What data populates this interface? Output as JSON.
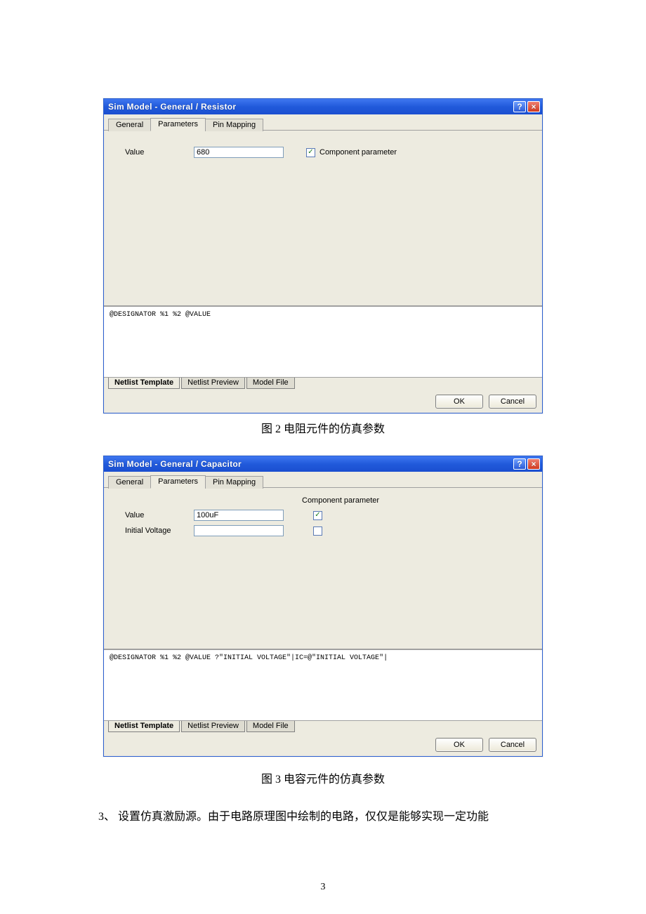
{
  "figure2": {
    "title": "Sim Model - General / Resistor",
    "tabs": [
      "General",
      "Parameters",
      "Pin Mapping"
    ],
    "active_tab": "Parameters",
    "rows": [
      {
        "label": "Value",
        "value": "680",
        "checked": true,
        "chk_label": "Component parameter"
      }
    ],
    "col_header": "",
    "netlist": "@DESIGNATOR %1 %2 @VALUE",
    "bottom_tabs": [
      "Netlist Template",
      "Netlist Preview",
      "Model File"
    ],
    "active_bottom": "Netlist Template",
    "ok": "OK",
    "cancel": "Cancel",
    "caption": "图 2  电阻元件的仿真参数"
  },
  "figure3": {
    "title": "Sim Model - General / Capacitor",
    "tabs": [
      "General",
      "Parameters",
      "Pin Mapping"
    ],
    "active_tab": "Parameters",
    "col_header": "Component parameter",
    "rows": [
      {
        "label": "Value",
        "value": "100uF",
        "checked": true,
        "chk_label": ""
      },
      {
        "label": "Initial Voltage",
        "value": "",
        "checked": false,
        "chk_label": ""
      }
    ],
    "netlist": "@DESIGNATOR %1 %2 @VALUE ?\"INITIAL VOLTAGE\"|IC=@\"INITIAL VOLTAGE\"|",
    "bottom_tabs": [
      "Netlist Template",
      "Netlist Preview",
      "Model File"
    ],
    "active_bottom": "Netlist Template",
    "ok": "OK",
    "cancel": "Cancel",
    "caption": "图 3  电容元件的仿真参数"
  },
  "body_paragraph": "3、  设置仿真激励源。由于电路原理图中绘制的电路，仅仅是能够实现一定功能",
  "page_number": "3"
}
